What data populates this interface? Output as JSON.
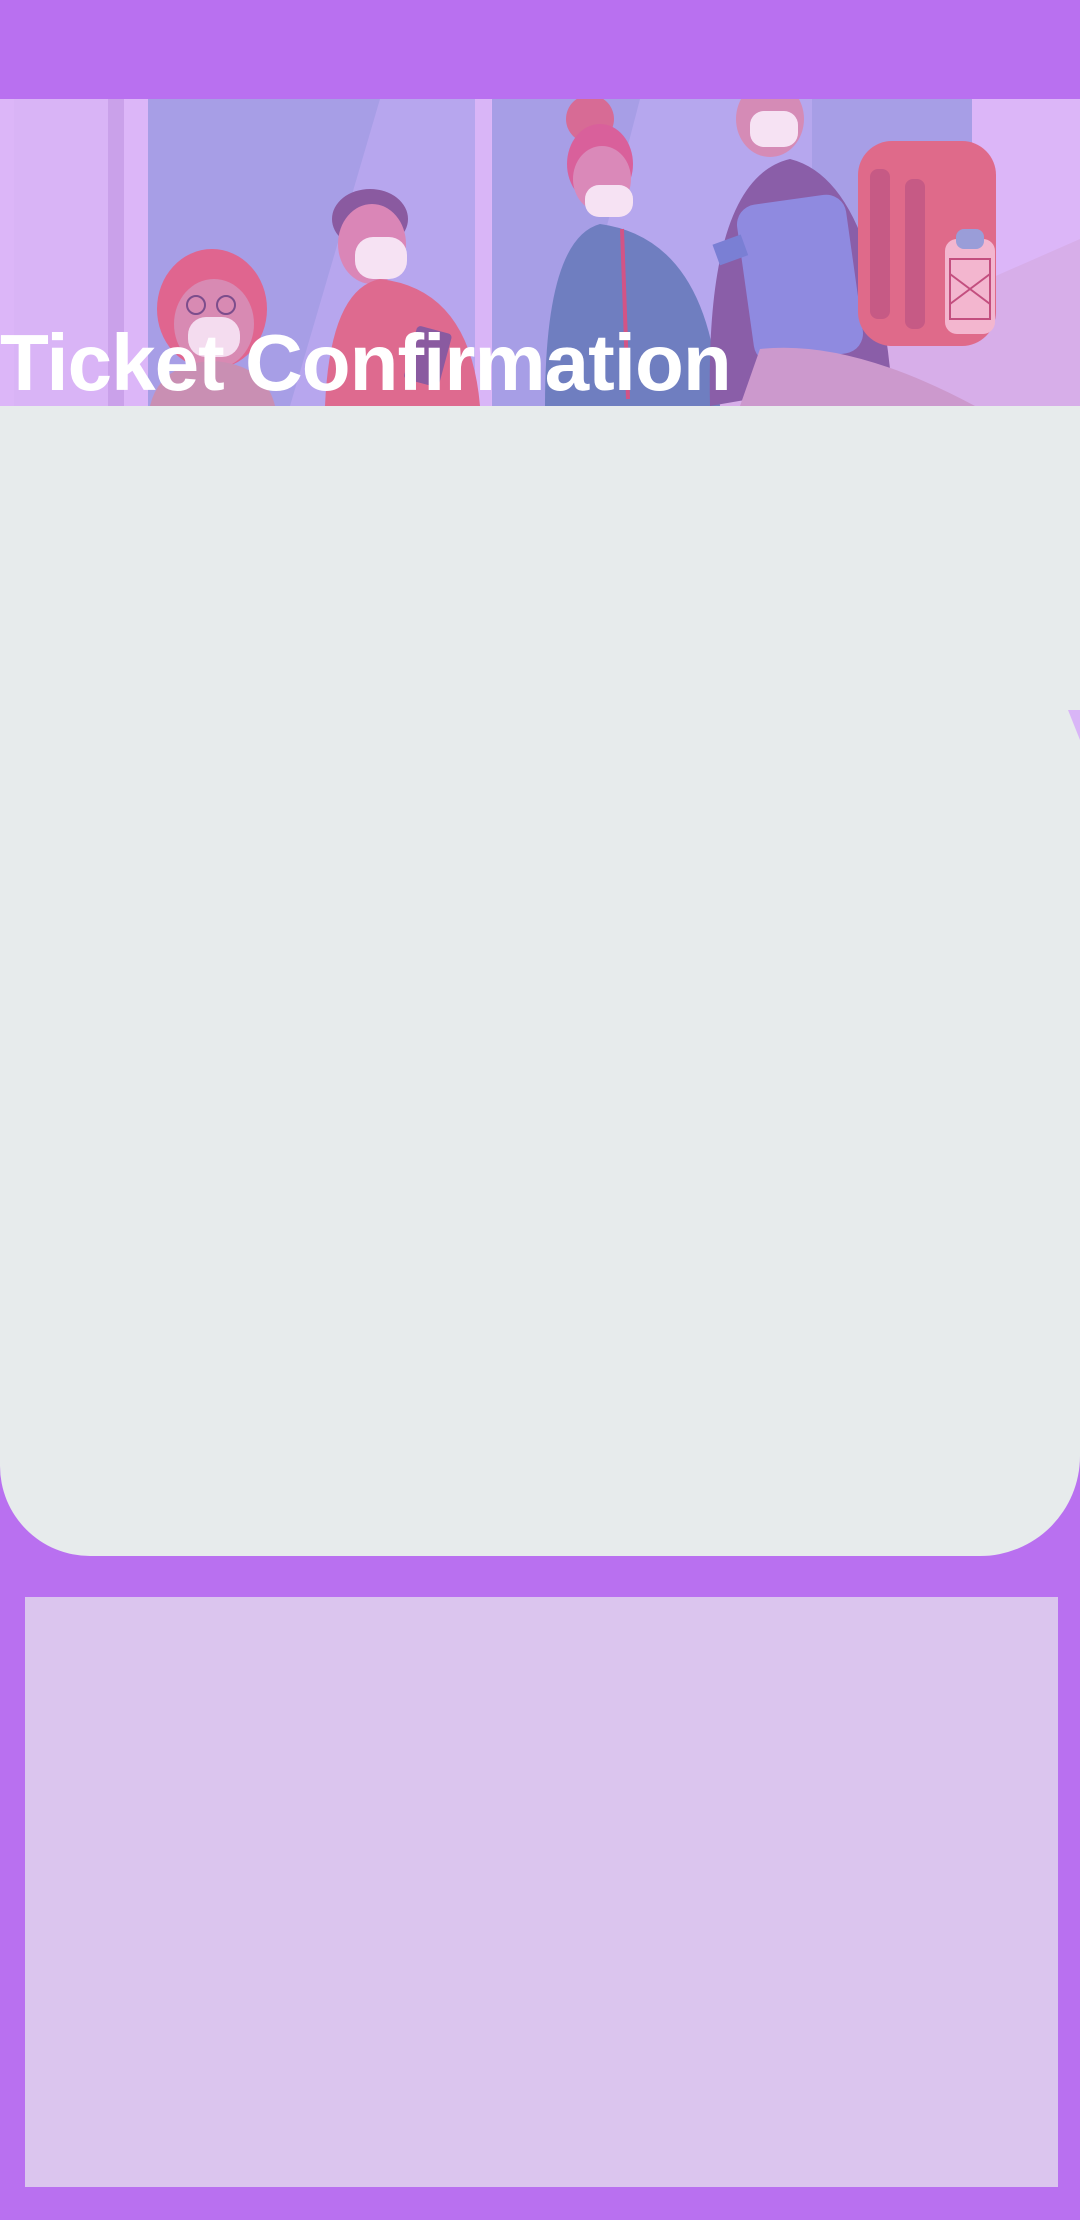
{
  "header": {
    "title": "Ticket Confirmation",
    "hero_image": "travelers-wearing-masks-illustration"
  },
  "colors": {
    "background": "#b970f0",
    "card": "#e7ebec",
    "bottom_panel": "#dbc5ee",
    "title_text": "#ffffff"
  }
}
